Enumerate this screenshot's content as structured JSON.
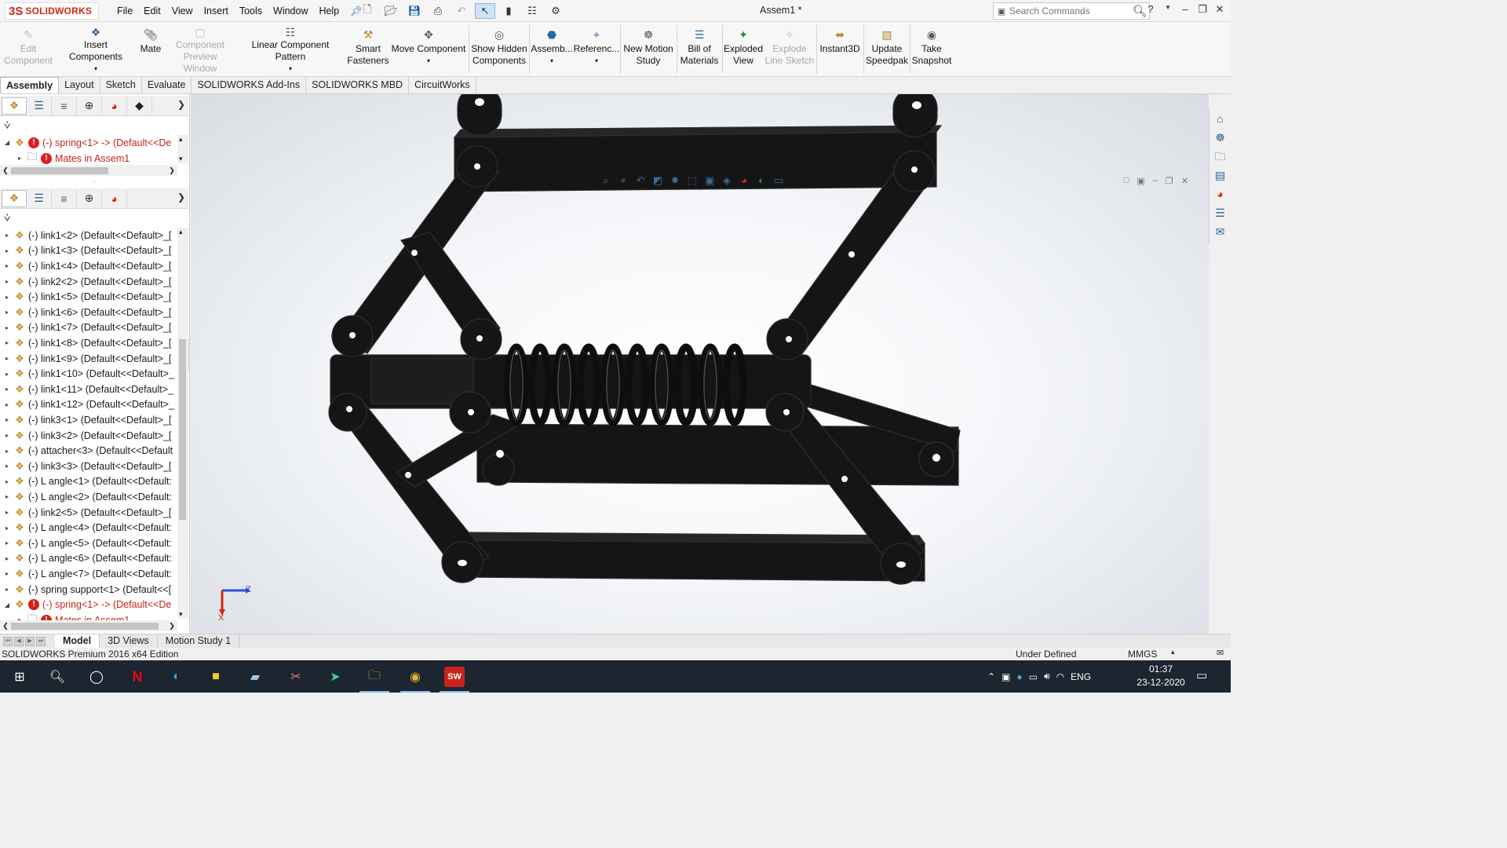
{
  "app": {
    "logo_mark": "3S",
    "logo_text": "SOLIDWORKS",
    "document_title": "Assem1 *"
  },
  "menu": [
    "File",
    "Edit",
    "View",
    "Insert",
    "Tools",
    "Window",
    "Help"
  ],
  "search": {
    "placeholder": "Search Commands"
  },
  "ribbon": {
    "buttons": [
      {
        "label1": "Edit",
        "label2": "Component",
        "icon": "edit-component-icon",
        "enabled": false
      },
      {
        "label1": "Insert Components",
        "label2": "",
        "icon": "insert-components-icon",
        "enabled": true
      },
      {
        "label1": "Mate",
        "label2": "",
        "icon": "mate-icon",
        "enabled": true
      },
      {
        "label1": "Component",
        "label2": "Preview Window",
        "icon": "component-preview-icon",
        "enabled": false
      },
      {
        "label1": "Linear Component Pattern",
        "label2": "",
        "icon": "linear-pattern-icon",
        "enabled": true
      },
      {
        "label1": "Smart",
        "label2": "Fasteners",
        "icon": "smart-fasteners-icon",
        "enabled": true
      },
      {
        "label1": "Move Component",
        "label2": "",
        "icon": "move-component-icon",
        "enabled": true
      },
      {
        "label1": "Show Hidden",
        "label2": "Components",
        "icon": "show-hidden-icon",
        "enabled": true
      },
      {
        "label1": "Assemb...",
        "label2": "",
        "icon": "assembly-features-icon",
        "enabled": true
      },
      {
        "label1": "Referenc...",
        "label2": "",
        "icon": "reference-geometry-icon",
        "enabled": true
      },
      {
        "label1": "New Motion",
        "label2": "Study",
        "icon": "motion-study-icon",
        "enabled": true
      },
      {
        "label1": "Bill of",
        "label2": "Materials",
        "icon": "bom-icon",
        "enabled": true
      },
      {
        "label1": "Exploded",
        "label2": "View",
        "icon": "exploded-view-icon",
        "enabled": true
      },
      {
        "label1": "Explode",
        "label2": "Line Sketch",
        "icon": "explode-line-icon",
        "enabled": false
      },
      {
        "label1": "Instant3D",
        "label2": "",
        "icon": "instant3d-icon",
        "enabled": true
      },
      {
        "label1": "Update",
        "label2": "Speedpak",
        "icon": "speedpak-icon",
        "enabled": true
      },
      {
        "label1": "Take",
        "label2": "Snapshot",
        "icon": "snapshot-icon",
        "enabled": true
      }
    ]
  },
  "command_tabs": [
    "Assembly",
    "Layout",
    "Sketch",
    "Evaluate",
    "SOLIDWORKS Add-Ins",
    "SOLIDWORKS MBD",
    "CircuitWorks"
  ],
  "top_tree": [
    {
      "text": "(-) spring<1> -> (Default<<De",
      "error": true,
      "expanded": true
    },
    {
      "text": "Mates in Assem1",
      "error": true,
      "expanded": false
    }
  ],
  "tree": [
    "(-) link1<2> (Default<<Default>_[",
    "(-) link1<3> (Default<<Default>_[",
    "(-) link1<4> (Default<<Default>_[",
    "(-) link2<2> (Default<<Default>_[",
    "(-) link1<5> (Default<<Default>_[",
    "(-) link1<6> (Default<<Default>_[",
    "(-) link1<7> (Default<<Default>_[",
    "(-) link1<8> (Default<<Default>_[",
    "(-) link1<9> (Default<<Default>_[",
    "(-) link1<10> (Default<<Default>_",
    "(-) link1<11> (Default<<Default>_",
    "(-) link1<12> (Default<<Default>_",
    "(-) link3<1> (Default<<Default>_[",
    "(-) link3<2> (Default<<Default>_[",
    "(-) attacher<3> (Default<<Default",
    "(-) link3<3> (Default<<Default>_[",
    "(-) L angle<1> (Default<<Default:",
    "(-) L angle<2> (Default<<Default:",
    "(-) link2<5> (Default<<Default>_[",
    "(-) L angle<4> (Default<<Default:",
    "(-) L angle<5> (Default<<Default:",
    "(-) L angle<6> (Default<<Default:",
    "(-) L angle<7> (Default<<Default:",
    "(-) spring support<1> (Default<<[",
    "(-) spring<1> -> (Default<<De",
    "Mates in Assem1"
  ],
  "triad": {
    "z": "Z",
    "x": "X"
  },
  "bottom_tabs": [
    "Model",
    "3D Views",
    "Motion Study 1"
  ],
  "status": {
    "edition": "SOLIDWORKS Premium 2016 x64 Edition",
    "state": "Under Defined",
    "units": "MMGS"
  },
  "taskbar": {
    "lang": "ENG",
    "time": "01:37",
    "date": "23-12-2020"
  },
  "colors": {
    "brand_red": "#d0281c",
    "error_red": "#c8221b",
    "model_black": "#141414",
    "taskbar_bg": "#1c2530"
  }
}
